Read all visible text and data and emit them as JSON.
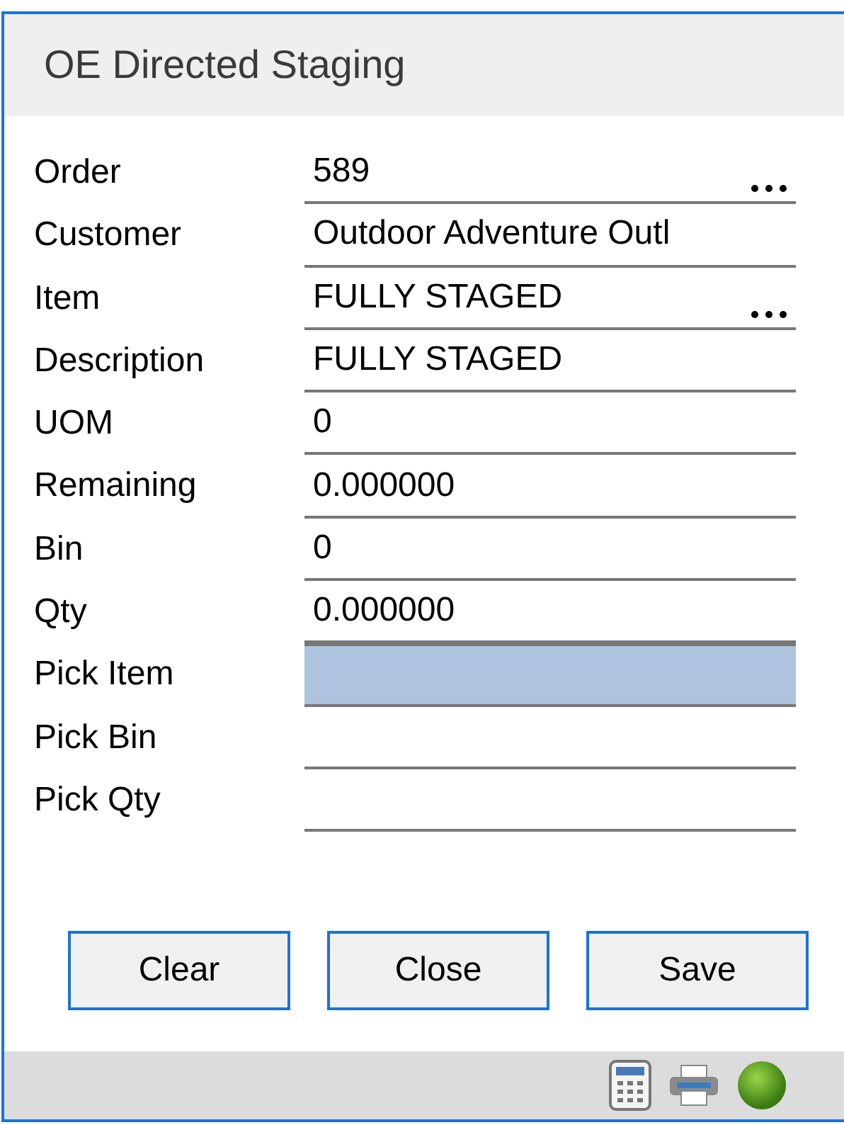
{
  "window": {
    "title": "OE Directed Staging"
  },
  "fields": [
    {
      "label": "Order",
      "value": "589",
      "lookup": true,
      "focused": false
    },
    {
      "label": "Customer",
      "value": "Outdoor Adventure Outl",
      "lookup": false,
      "focused": false
    },
    {
      "label": "Item",
      "value": "FULLY STAGED",
      "lookup": true,
      "focused": false
    },
    {
      "label": "Description",
      "value": "FULLY STAGED",
      "lookup": false,
      "focused": false
    },
    {
      "label": "UOM",
      "value": "0",
      "lookup": false,
      "focused": false
    },
    {
      "label": "Remaining",
      "value": "0.000000",
      "lookup": false,
      "focused": false
    },
    {
      "label": "Bin",
      "value": "0",
      "lookup": false,
      "focused": false
    },
    {
      "label": "Qty",
      "value": "0.000000",
      "lookup": false,
      "focused": false
    },
    {
      "label": "Pick Item",
      "lookup": false,
      "focused": true
    },
    {
      "label": "Pick Bin",
      "lookup": false,
      "focused": false
    },
    {
      "label": "Pick Qty",
      "lookup": false,
      "focused": false
    }
  ],
  "buttons": [
    "Clear",
    "Close",
    "Save"
  ]
}
